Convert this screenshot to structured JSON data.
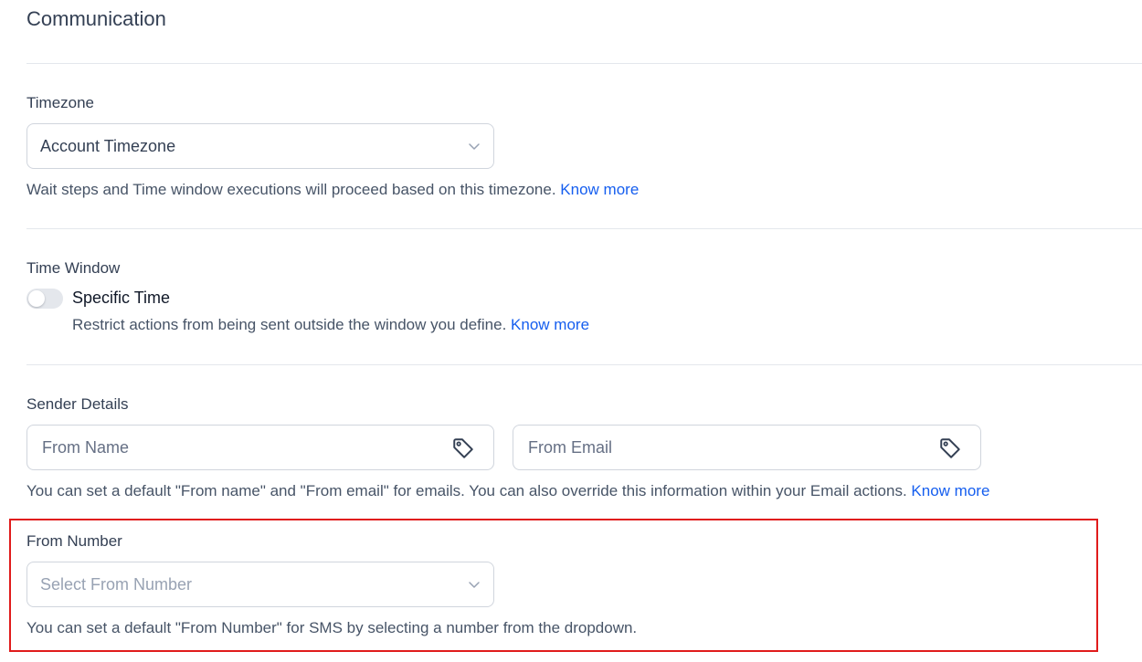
{
  "page": {
    "title": "Communication"
  },
  "timezone": {
    "label": "Timezone",
    "selected": "Account Timezone",
    "helper": "Wait steps and Time window executions will proceed based on this timezone.",
    "link": "Know more"
  },
  "time_window": {
    "label": "Time Window",
    "toggle_label": "Specific Time",
    "toggle_on": false,
    "helper": "Restrict actions from being sent outside the window you define.",
    "link": "Know more"
  },
  "sender_details": {
    "label": "Sender Details",
    "from_name_placeholder": "From Name",
    "from_email_placeholder": "From Email",
    "helper": "You can set a default \"From name\" and \"From email\" for emails. You can also override this information within your Email actions.",
    "link": "Know more"
  },
  "from_number": {
    "label": "From Number",
    "placeholder": "Select From Number",
    "helper": "You can set a default \"From Number\" for SMS by selecting a number from the dropdown."
  },
  "icons": {
    "chevron": "chevron-down-icon",
    "tag": "tag-icon"
  },
  "colors": {
    "link": "#155eef",
    "highlight": "#e01b1b",
    "toggle_off": "#e4e7ec"
  }
}
